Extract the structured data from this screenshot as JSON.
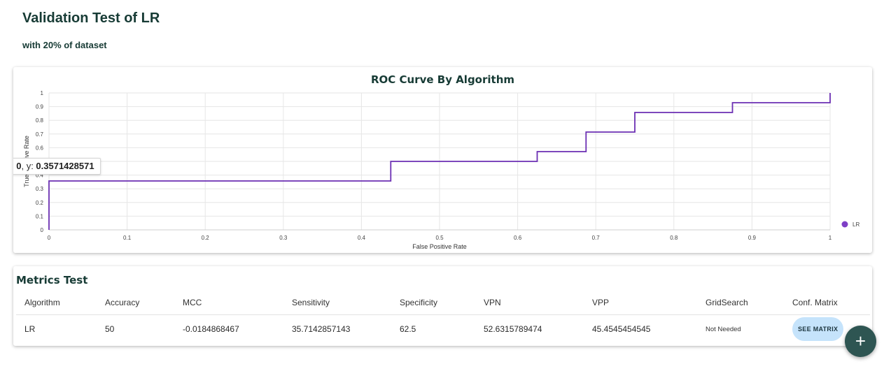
{
  "page": {
    "title": "Validation Test of LR",
    "subtitle": "with 20% of dataset"
  },
  "chart_data": {
    "type": "line",
    "title": "ROC Curve By Algorithm",
    "xlabel": "False Positive Rate",
    "ylabel": "True Positive Rate",
    "xlim": [
      0,
      1
    ],
    "ylim": [
      0,
      1
    ],
    "grid": true,
    "legend_placement": "right",
    "x_ticks": [
      "0",
      "0.1",
      "0.2",
      "0.3",
      "0.4",
      "0.5",
      "0.6",
      "0.7",
      "0.8",
      "0.9",
      "1"
    ],
    "y_ticks": [
      "0",
      "0.1",
      "0.2",
      "0.3",
      "0.4",
      "0.5",
      "0.6",
      "0.7",
      "0.8",
      "0.9",
      "1"
    ],
    "series": [
      {
        "name": "LR",
        "color": "#6b2fb3",
        "x": [
          0,
          0,
          0.4375,
          0.4375,
          0.625,
          0.625,
          0.6875,
          0.6875,
          0.75,
          0.75,
          0.875,
          0.875,
          1,
          1
        ],
        "y": [
          0,
          0.3571428571,
          0.3571428571,
          0.5,
          0.5,
          0.5714285714,
          0.5714285714,
          0.7142857143,
          0.7142857143,
          0.8571428571,
          0.8571428571,
          0.9285714286,
          0.9285714286,
          1
        ]
      }
    ],
    "tooltip": {
      "x_prefix": ": ",
      "x_value": "0",
      "y_prefix": ", y: ",
      "y_value": "0.3571428571"
    }
  },
  "legend": {
    "marker_color": "#7e3fc6"
  },
  "metrics": {
    "title": "Metrics Test",
    "columns": [
      "Algorithm",
      "Accuracy",
      "MCC",
      "Sensitivity",
      "Specificity",
      "VPN",
      "VPP",
      "GridSearch",
      "Conf. Matrix"
    ],
    "rows": [
      {
        "algorithm": "LR",
        "accuracy": "50",
        "mcc": "-0.0184868467",
        "sensitivity": "35.7142857143",
        "specificity": "62.5",
        "vpn": "52.6315789474",
        "vpp": "45.4545454545",
        "gridsearch": "Not Needed",
        "matrix_button": "SEE MATRIX"
      }
    ]
  },
  "fab": {
    "icon": "plus-icon",
    "label": "+"
  }
}
